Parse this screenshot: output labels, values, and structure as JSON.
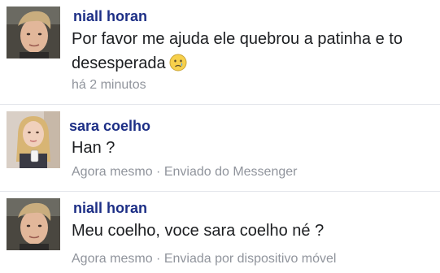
{
  "messages": [
    {
      "sender": "niall horan",
      "text": "Por favor me ajuda ele quebrou a patinha e to desesperada",
      "emoji": "crying-face-icon",
      "time": "há 2 minutos",
      "source": ""
    },
    {
      "sender": "sara coelho",
      "text": "Han ?",
      "time": "Agora mesmo",
      "source": "Enviado do Messenger"
    },
    {
      "sender": "niall horan",
      "text": "Meu coelho, voce sara coelho né ?",
      "time": "Agora mesmo",
      "source": "Enviada por dispositivo móvel"
    }
  ],
  "separator": " · ",
  "colors": {
    "sender_name": "#1d2f86",
    "message_text": "#1c1e21",
    "meta_text": "#90949c",
    "divider": "#e4e6eb"
  }
}
